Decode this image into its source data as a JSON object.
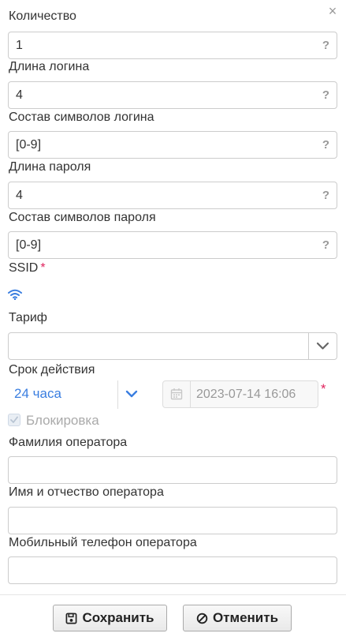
{
  "dialog": {
    "close_symbol": "×",
    "help_symbol": "?"
  },
  "fields": {
    "quantity": {
      "label": "Количество",
      "value": "1"
    },
    "login_length": {
      "label": "Длина логина",
      "value": "4"
    },
    "login_charset": {
      "label": "Состав символов логина",
      "value": "[0-9]"
    },
    "password_length": {
      "label": "Длина пароля",
      "value": "4"
    },
    "password_charset": {
      "label": "Состав символов пароля",
      "value": "[0-9]"
    }
  },
  "ssid": {
    "label": "SSID",
    "required_mark": "*",
    "icon": "wifi-icon"
  },
  "tariff": {
    "label": "Тариф",
    "value": ""
  },
  "validity": {
    "label": "Срок действия",
    "duration": "24 часа",
    "datetime": "2023-07-14 16:06",
    "required_mark": "*"
  },
  "blocking": {
    "label": "Блокировка",
    "checked": true
  },
  "operator": {
    "surname_label": "Фамилия оператора",
    "surname_value": "",
    "name_label": "Имя и отчество оператора",
    "name_value": "",
    "phone_label": "Мобильный телефон оператора",
    "phone_value": ""
  },
  "buttons": {
    "save_label": "Сохранить",
    "cancel_label": "Отменить"
  },
  "colors": {
    "accent": "#3a7ee0",
    "required": "#e0245e",
    "border": "#cccccc"
  }
}
